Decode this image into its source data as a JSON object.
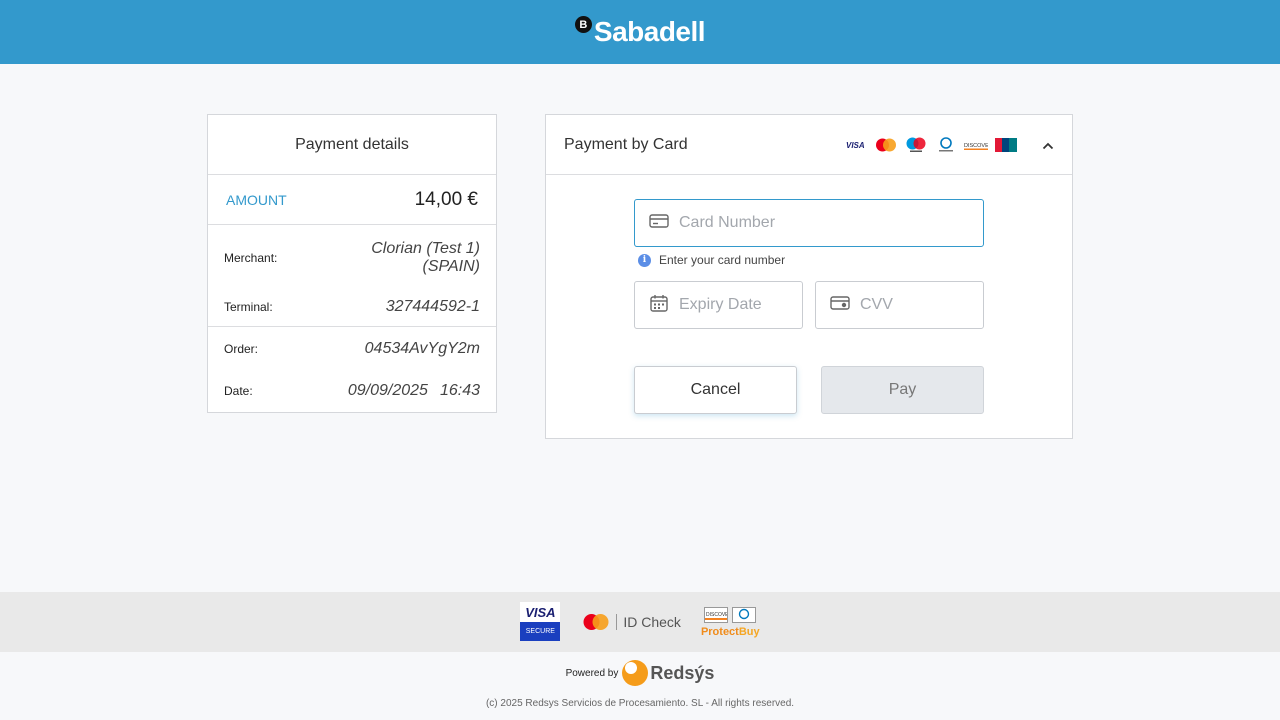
{
  "header": {
    "logo_mark": "B",
    "logo_text": "Sabadell"
  },
  "details": {
    "title": "Payment details",
    "amount_label": "AMOUNT",
    "amount_value": "14,00 €",
    "merchant_label": "Merchant:",
    "merchant_value_line1": "Clorian (Test 1)",
    "merchant_value_line2": "(SPAIN)",
    "terminal_label": "Terminal:",
    "terminal_value": "327444592-1",
    "order_label": "Order:",
    "order_value": "04534AvYgY2m",
    "date_label": "Date:",
    "date_value": "09/09/2025",
    "time_value": "16:43"
  },
  "card_panel": {
    "title": "Payment by Card",
    "brand_icons": [
      "visa-icon",
      "mastercard-icon",
      "maestro-icon",
      "diners-icon",
      "discover-icon",
      "unionpay-icon"
    ],
    "card_number_placeholder": "Card Number",
    "card_hint": "Enter your card number",
    "expiry_placeholder": "Expiry Date",
    "cvv_placeholder": "CVV",
    "cancel_label": "Cancel",
    "pay_label": "Pay"
  },
  "footer": {
    "visa_top": "VISA",
    "visa_bottom": "SECURE",
    "idcheck_label": "ID Check",
    "protectbuy_a": "Protect",
    "protectbuy_b": "Buy",
    "powered_by": "Powered by",
    "redsys": "Redsýs",
    "copyright": "(c) 2025 Redsys Servicios de Procesamiento. SL - All rights reserved."
  },
  "colors": {
    "brand_blue": "#3399cc",
    "pay_disabled": "#e5e8ec"
  }
}
